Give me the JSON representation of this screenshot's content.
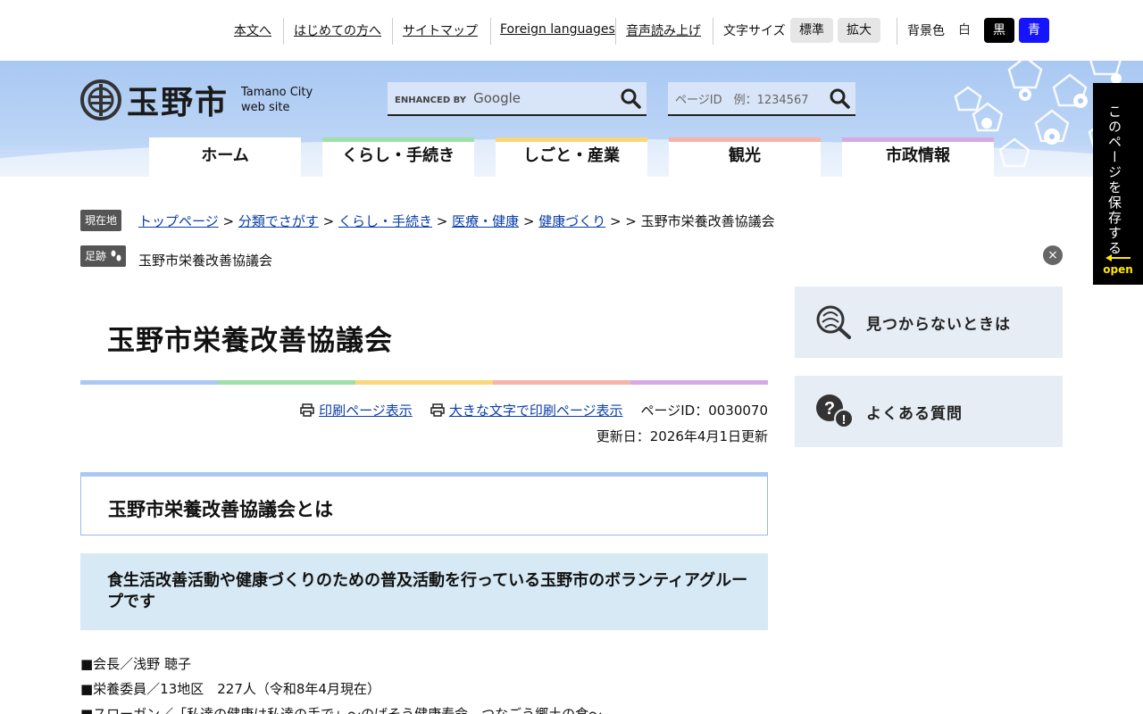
{
  "util": {
    "skip": "本文へ",
    "first_time": "はじめての方へ",
    "sitemap": "サイトマップ",
    "foreign": "Foreign languages",
    "voice": "音声読み上げ",
    "font_size_label": "文字サイズ",
    "font_standard": "標準",
    "font_large": "拡大",
    "bg_label": "背景色",
    "bg_white": "白",
    "bg_black": "黒",
    "bg_blue": "青"
  },
  "header": {
    "city_name": "玉野市",
    "city_en_1": "Tamano City",
    "city_en_2": "web site",
    "google_enhanced": "ENHANCED BY",
    "google_brand": "Google",
    "page_id_placeholder": "ページID　例：1234567"
  },
  "nav": {
    "items": [
      {
        "label": "ホーム",
        "color": "#ffffff"
      },
      {
        "label": "くらし・手続き",
        "color": "#9ee0a8"
      },
      {
        "label": "しごと・産業",
        "color": "#fcd77a"
      },
      {
        "label": "観光",
        "color": "#f6b3a6"
      },
      {
        "label": "市政情報",
        "color": "#d6a9e6"
      }
    ]
  },
  "breadcrumb": {
    "tag": "現在地",
    "links": [
      "トップページ",
      "分類でさがす",
      "くらし・手続き",
      "医療・健康",
      "健康づくり"
    ],
    "current": "玉野市栄養改善協議会"
  },
  "footprints": {
    "tag": "足跡",
    "item": "玉野市栄養改善協議会",
    "close": "×"
  },
  "sidetab": {
    "label": "このページを保存する",
    "open": "open"
  },
  "main": {
    "title": "玉野市栄養改善協議会",
    "rainbow": [
      "#a9c8f2",
      "#9ee0a8",
      "#fcd77a",
      "#f6b3a6",
      "#d6a9e6"
    ],
    "print_label": "印刷ページ表示",
    "print_large_label": "大きな文字で印刷ページ表示",
    "page_id": "ページID：0030070",
    "updated": "更新日：2026年4月1日更新",
    "h2": "玉野市栄養改善協議会とは",
    "h3": "食生活改善活動や健康づくりのための普及活動を行っている玉野市のボランティアグループです",
    "lines": [
      "■会長／浅野 聴子",
      "■栄養委員／13地区　227人（令和8年4月現在）",
      "■スローガン／「私達の健康は私達の手で」～のばそう健康寿命　つなごう郷土の食～"
    ]
  },
  "side": {
    "not_found": "見つからないときは",
    "faq": "よくある質問"
  }
}
